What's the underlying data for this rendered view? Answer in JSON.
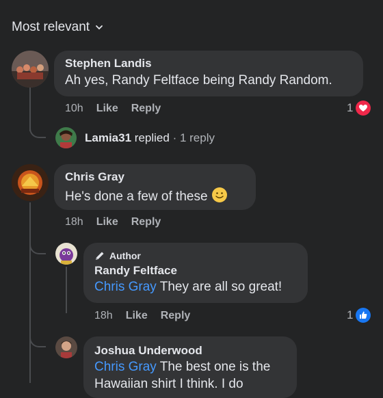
{
  "sort": {
    "label": "Most relevant"
  },
  "comments": [
    {
      "author": "Stephen Landis",
      "text": "Ah yes, Randy Feltface being Randy Random.",
      "time": "10h",
      "like_label": "Like",
      "reply_label": "Reply",
      "reaction_count": "1"
    },
    {
      "author": "Chris Gray",
      "text": "He's done a few of these",
      "time": "18h",
      "like_label": "Like",
      "reply_label": "Reply"
    }
  ],
  "replies_summary": {
    "name": "Lamia31",
    "replied": "replied",
    "count": "· 1 reply"
  },
  "reply_randy": {
    "badge": "Author",
    "author": "Randy Feltface",
    "mention": "Chris Gray",
    "text": " They are all so great!",
    "time": "18h",
    "like_label": "Like",
    "reply_label": "Reply",
    "reaction_count": "1"
  },
  "reply_joshua": {
    "author": "Joshua Underwood",
    "mention": "Chris Gray",
    "text": " The best one is the",
    "text2": "Hawaiian shirt I think. I do"
  },
  "colors": {
    "mention": "#4599ff",
    "heart": "#f0284a",
    "like": "#1877f2",
    "background": "#232425",
    "bubble": "#333436"
  }
}
